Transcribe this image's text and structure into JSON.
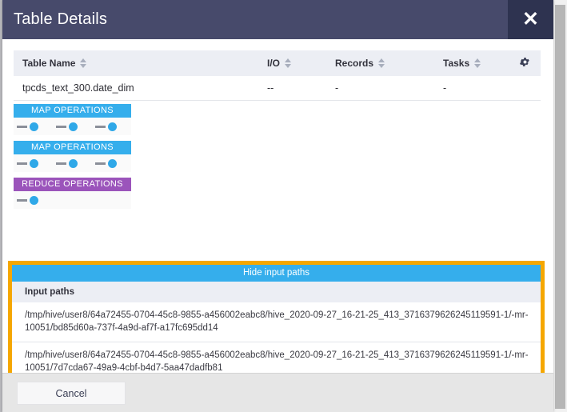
{
  "dialog": {
    "title": "Table Details",
    "close_label": "✕"
  },
  "table": {
    "columns": [
      {
        "label": "Table Name",
        "sortable": true
      },
      {
        "label": "I/O",
        "sortable": true
      },
      {
        "label": "Records",
        "sortable": true
      },
      {
        "label": "Tasks",
        "sortable": true
      }
    ],
    "settings_icon": "gear-icon",
    "rows": [
      {
        "table_name": "tpcds_text_300.date_dim",
        "io": "--",
        "records": "-",
        "tasks": "-"
      }
    ]
  },
  "stages": [
    {
      "label": "MAP OPERATIONS",
      "type": "map",
      "color": "#35aeec",
      "node_count": 3
    },
    {
      "label": "MAP OPERATIONS",
      "type": "map",
      "color": "#35aeec",
      "node_count": 3
    },
    {
      "label": "REDUCE OPERATIONS",
      "type": "reduce",
      "color": "#9b54bb",
      "node_count": 1
    }
  ],
  "input_paths_panel": {
    "highlight_color": "#f5a700",
    "toggle_label": "Hide input paths",
    "section_label": "Input paths",
    "paths": [
      "/tmp/hive/user8/64a72455-0704-45c8-9855-a456002eabc8/hive_2020-09-27_16-21-25_413_3716379626245119591-1/-mr-10051/bd85d60a-737f-4a9d-af7f-a17fc695dd14",
      "/tmp/hive/user8/64a72455-0704-45c8-9855-a456002eabc8/hive_2020-09-27_16-21-25_413_3716379626245119591-1/-mr-10051/7d7cda67-49a9-4cbf-b4d7-5aa47dadfb81"
    ]
  },
  "footer": {
    "cancel_label": "Cancel"
  }
}
